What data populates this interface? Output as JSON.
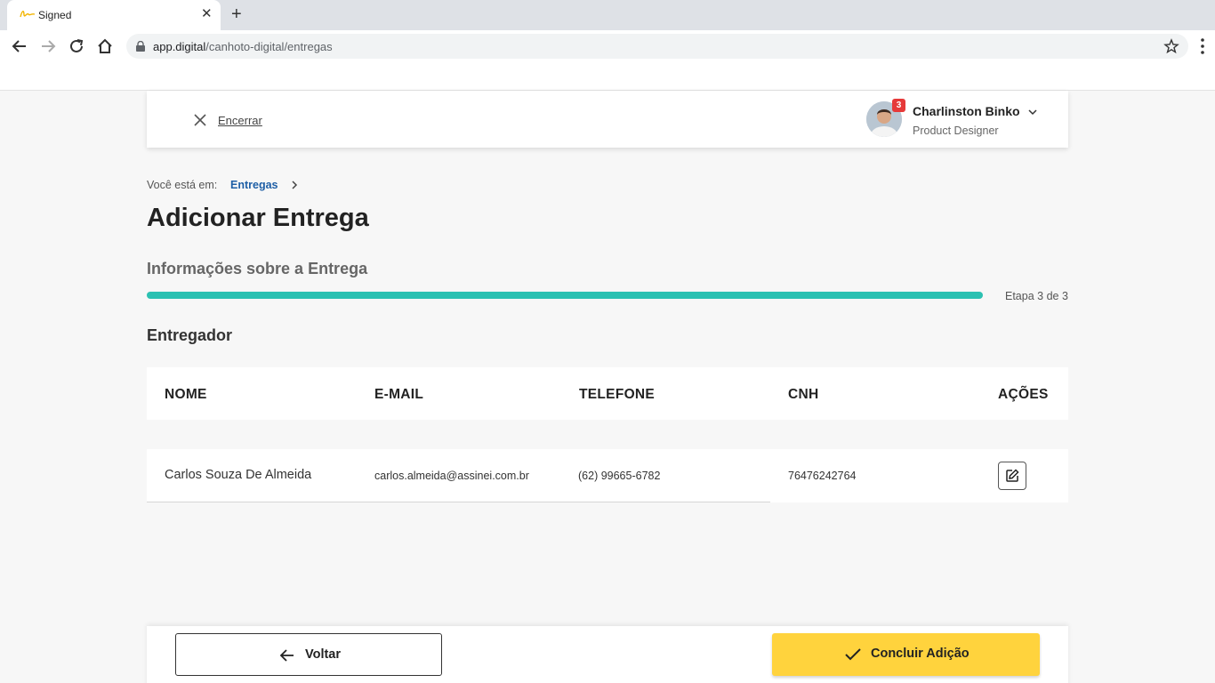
{
  "browser": {
    "tab_title": "Signed",
    "close_tab": "✕",
    "new_tab": "+",
    "url_host": "app.digital",
    "url_path": "/canhoto-digital/entregas"
  },
  "header": {
    "close_label": "Encerrar",
    "user": {
      "name": "Charlinston Binko",
      "role": "Product Designer",
      "notification_count": "3"
    }
  },
  "breadcrumb": {
    "label": "Você está em:",
    "link": "Entregas"
  },
  "page": {
    "title": "Adicionar Entrega",
    "section": "Informações sobre a Entrega",
    "progress": 1.0,
    "step_label": "Etapa 3 de 3",
    "group_title": "Entregador"
  },
  "table": {
    "columns": [
      "NOME",
      "E-MAIL",
      "TELEFONE",
      "CNH",
      "AÇÕES"
    ],
    "rows": [
      {
        "name": "Carlos Souza De Almeida",
        "email": "carlos.almeida@assinei.com.br",
        "phone": "(62) 99665-6782",
        "cnh": "76476242764"
      }
    ]
  },
  "footer": {
    "back_label": "Voltar",
    "done_label": "Concluir Adição"
  },
  "colors": {
    "accent_teal": "#2cc1b2",
    "primary_yellow": "#ffd33d",
    "link_blue": "#1e5fa6",
    "badge_red": "#e63939"
  }
}
